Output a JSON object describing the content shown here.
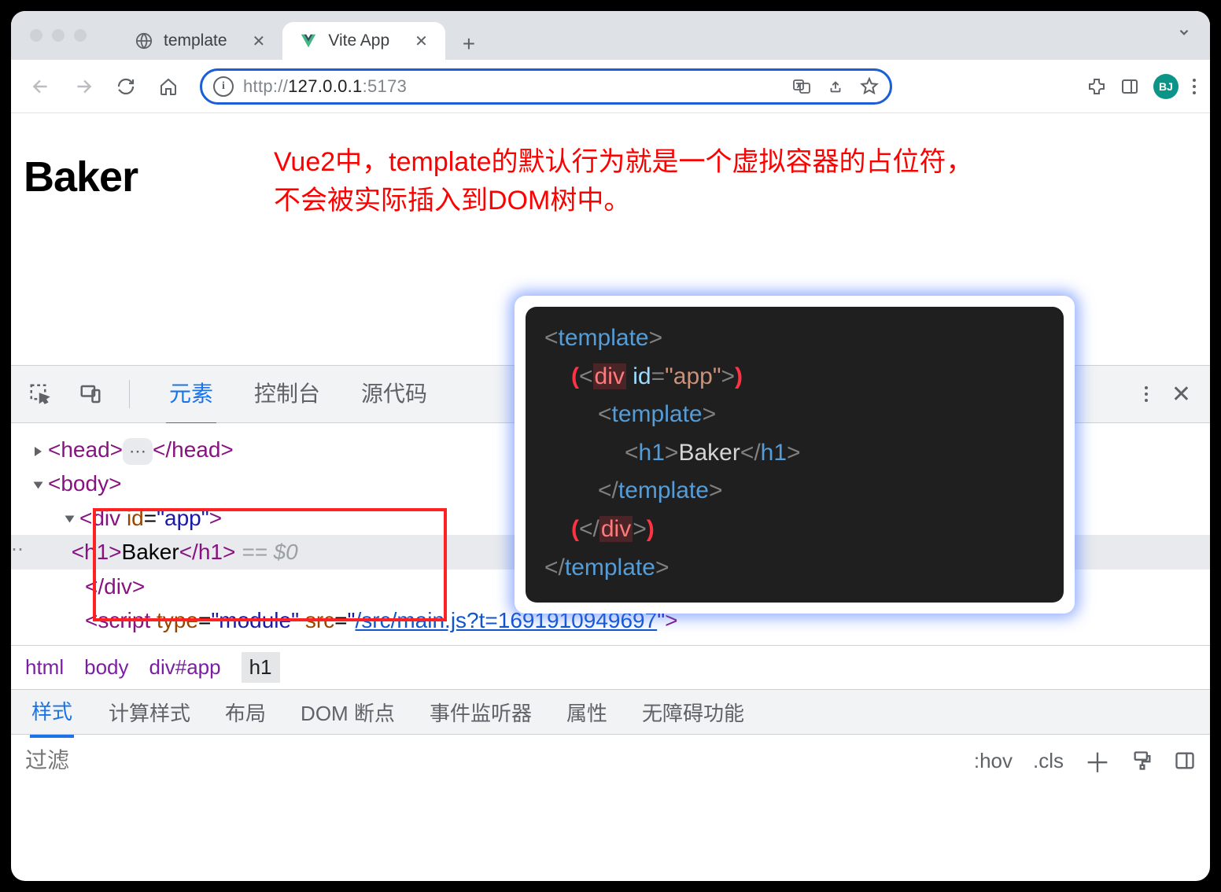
{
  "tabs": [
    {
      "title": "template",
      "active": false
    },
    {
      "title": "Vite App",
      "active": true
    }
  ],
  "url": {
    "protocol": "http://",
    "host": "127.0.0.1",
    "port": ":5173"
  },
  "avatar": "BJ",
  "page": {
    "heading": "Baker",
    "annotation_line1": "Vue2中，template的默认行为就是一个虚拟容器的占位符，",
    "annotation_line2": "不会被实际插入到DOM树中。"
  },
  "devtools": {
    "tabs": [
      "元素",
      "控制台",
      "源代码"
    ],
    "active_tab": "元素"
  },
  "tree": {
    "head_open": "<head>",
    "head_close": "</head>",
    "body_open": "<body>",
    "div_open": "<div ",
    "div_attr": "id",
    "div_eq": "=",
    "div_val": "\"app\"",
    "div_open_end": ">",
    "h1_open": "<h1>",
    "h1_text": "Baker",
    "h1_close": "</h1>",
    "sel_suffix": " == $0",
    "div_close": "</div>",
    "script_open": "<script ",
    "script_attr1": "type",
    "script_val1": "\"module\"",
    "script_attr2": "src",
    "script_link": "/src/main.js?t=1691910949697",
    "script_open_end": ">"
  },
  "editor": {
    "l1": "<template>",
    "l2_pre": "<",
    "l2_div": "div",
    "l2_sp": " ",
    "l2_id": "id",
    "l2_eq": "=",
    "l2_val": "\"app\"",
    "l2_post": ">",
    "l3": "<template>",
    "l4_pre": "<",
    "l4_h1": "h1",
    "l4_gt": ">",
    "l4_txt": "Baker",
    "l4_ch1": "</",
    "l4_h1c": "h1",
    "l4_cgt": ">",
    "l5": "</template>",
    "l6_pre": "</",
    "l6_div": "div",
    "l6_gt": ">",
    "l7": "</template>"
  },
  "breadcrumb": [
    "html",
    "body",
    "div#app",
    "h1"
  ],
  "styles_tabs": [
    "样式",
    "计算样式",
    "布局",
    "DOM 断点",
    "事件监听器",
    "属性",
    "无障碍功能"
  ],
  "filter": {
    "placeholder": "过滤",
    "hov": ":hov",
    "cls": ".cls"
  }
}
